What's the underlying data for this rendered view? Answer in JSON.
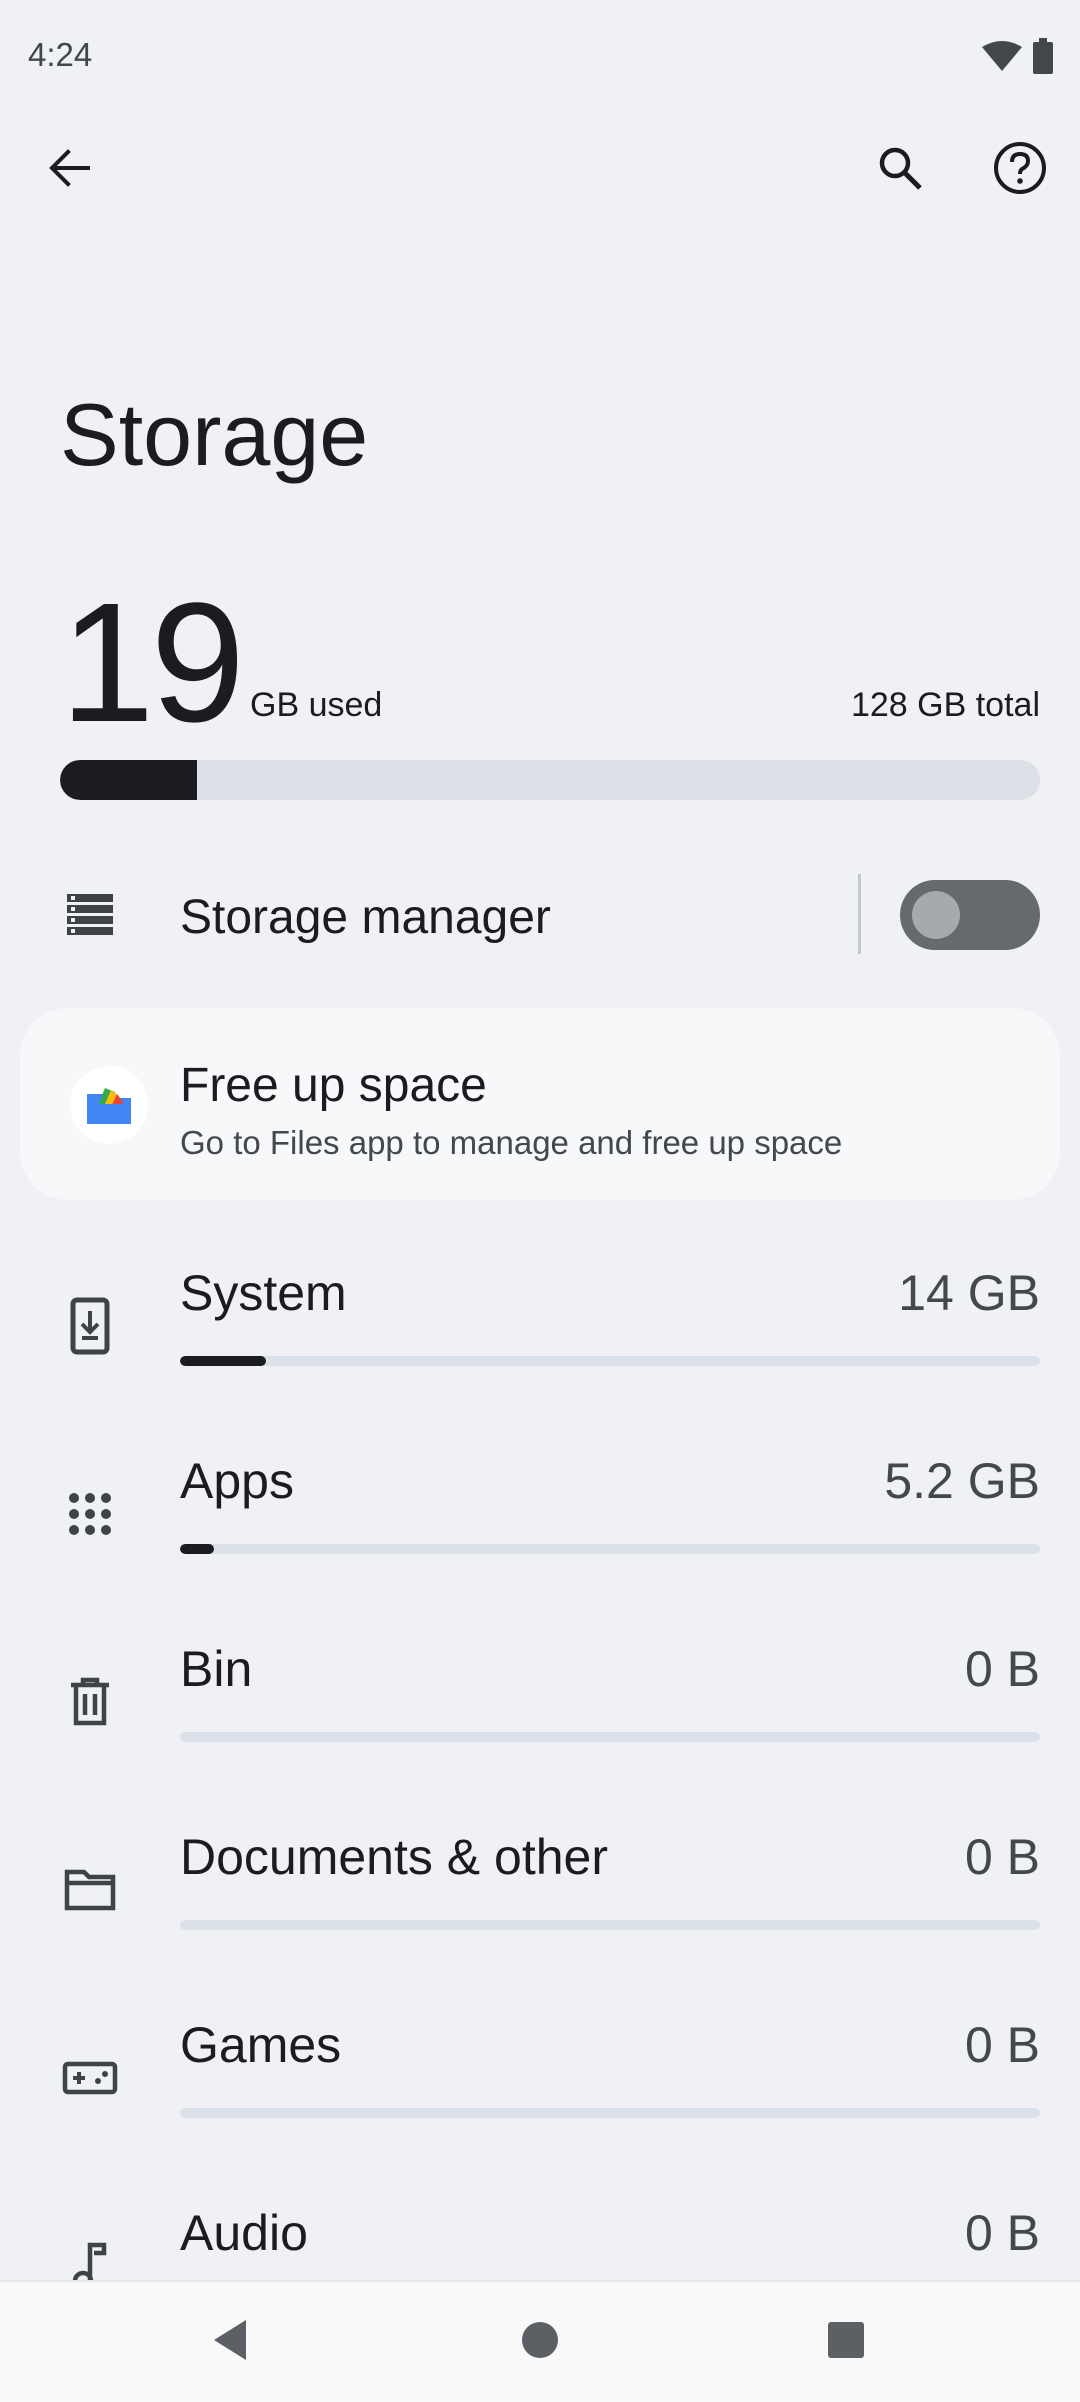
{
  "status_bar": {
    "time": "4:24",
    "icons": [
      "wifi-icon",
      "battery-icon"
    ]
  },
  "toolbar": {
    "back_icon": "back-arrow-icon",
    "search_icon": "search-icon",
    "help_icon": "help-icon"
  },
  "page": {
    "title": "Storage"
  },
  "usage": {
    "used_value": "19",
    "used_unit": "GB used",
    "total_label": "128 GB total",
    "used_fraction": 0.14
  },
  "storage_manager": {
    "label": "Storage manager",
    "enabled": false
  },
  "free_up": {
    "title": "Free up space",
    "subtitle": "Go to Files app to manage and free up space"
  },
  "categories": [
    {
      "label": "System",
      "size": "14 GB",
      "fraction": 0.1,
      "icon": "system-update-icon"
    },
    {
      "label": "Apps",
      "size": "5.2 GB",
      "fraction": 0.04,
      "icon": "apps-grid-icon"
    },
    {
      "label": "Bin",
      "size": "0 B",
      "fraction": 0,
      "icon": "trash-icon"
    },
    {
      "label": "Documents & other",
      "size": "0 B",
      "fraction": 0,
      "icon": "folder-icon"
    },
    {
      "label": "Games",
      "size": "0 B",
      "fraction": 0,
      "icon": "gamepad-icon"
    },
    {
      "label": "Audio",
      "size": "0 B",
      "fraction": 0,
      "icon": "music-note-icon"
    }
  ],
  "colors": {
    "background": "#eff1f4",
    "bar_fill": "#1a1c20",
    "bar_track": "#dce1e8",
    "toggle_off": "#646a6d"
  }
}
